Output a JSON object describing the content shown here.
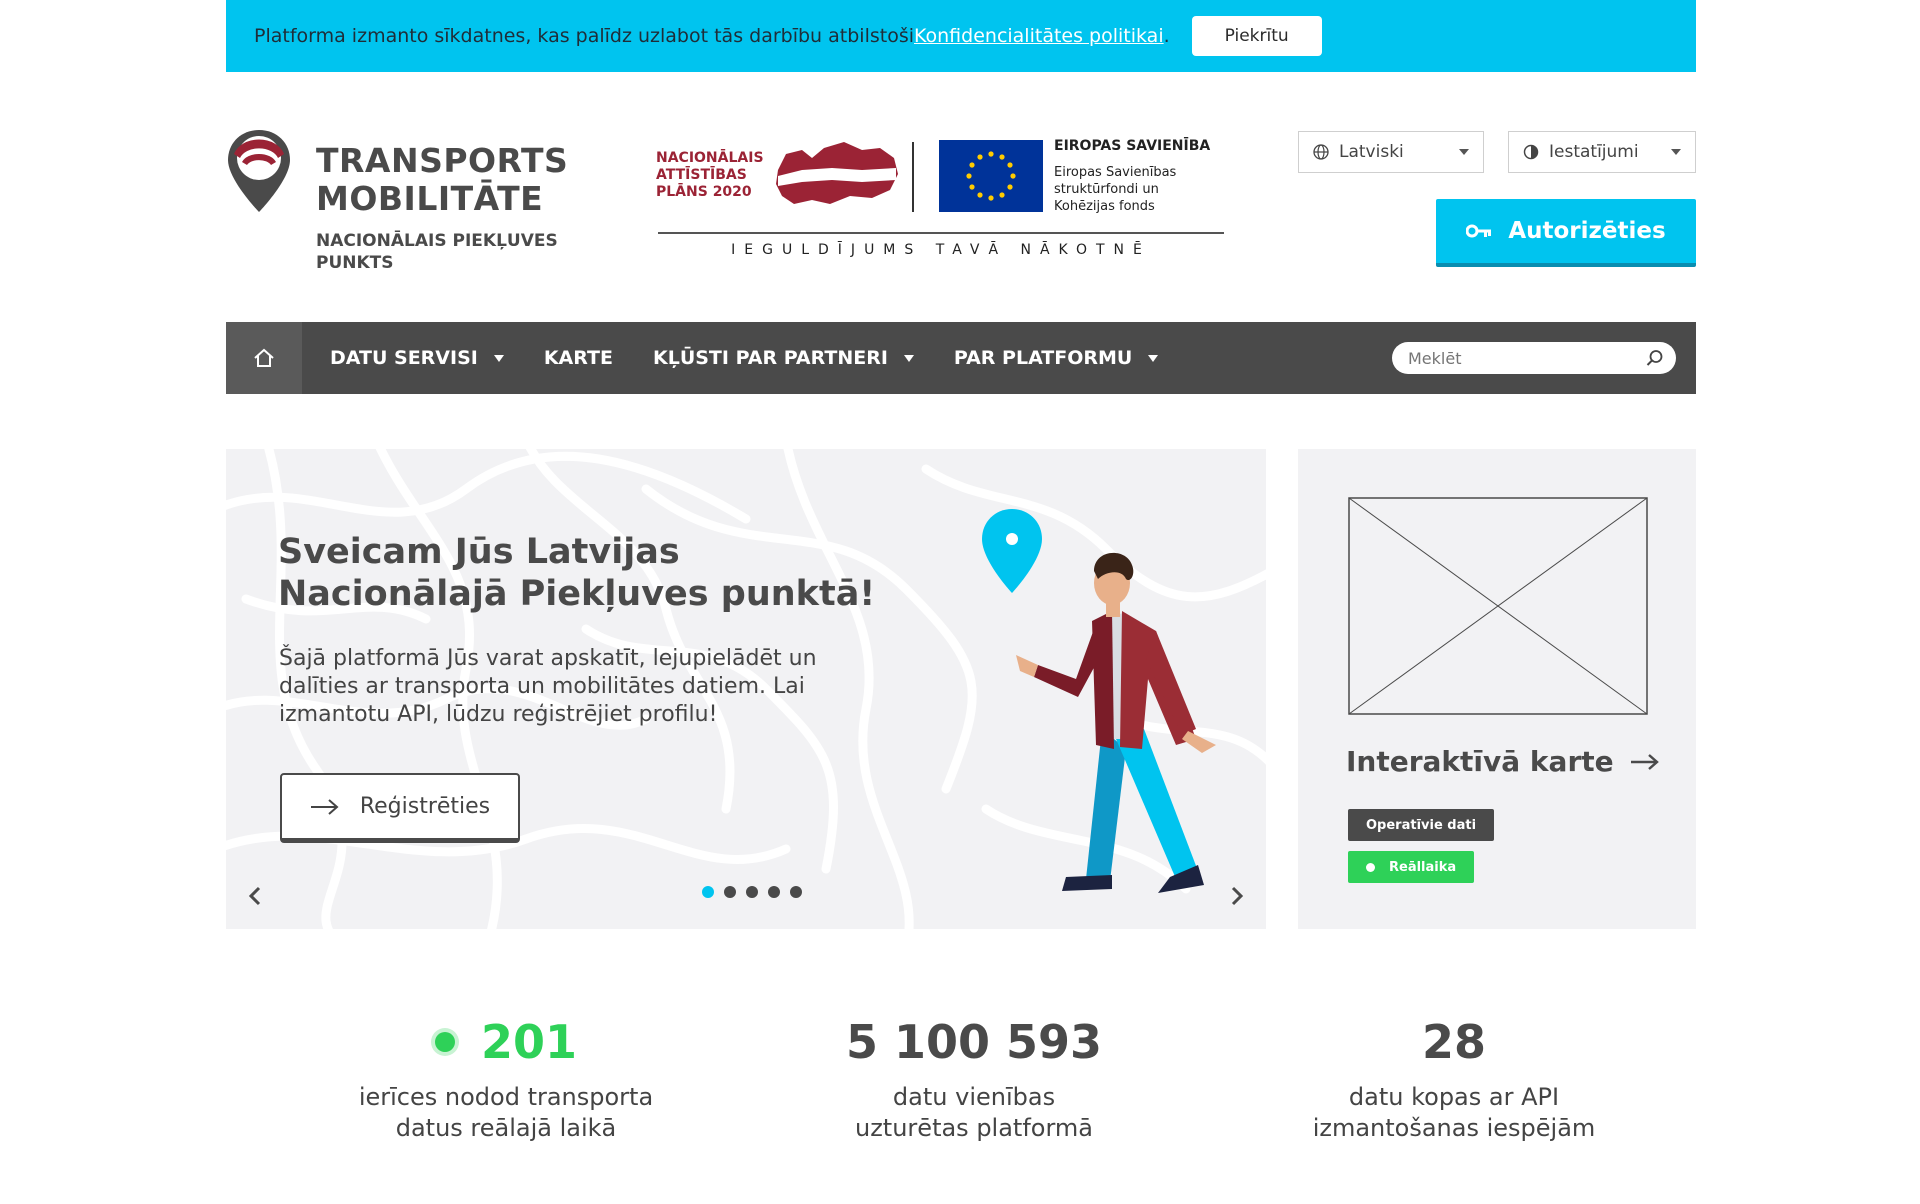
{
  "cookie_banner": {
    "text": "Platforma izmanto sīkdatnes, kas palīdz uzlabot tās darbību atbilstoši ",
    "link": "Konfidencialitātes politikai",
    "after_link": ".",
    "accept_label": "Piekrītu"
  },
  "logo": {
    "title_line1": "TRANSPORTS",
    "title_line2": "MOBILITĀTE",
    "subtitle_line1": "NACIONĀLAIS PIEKĻUVES",
    "subtitle_line2": "PUNKTS"
  },
  "funding": {
    "nap_line1": "NACIONĀLAIS",
    "nap_line2": "ATTĪSTĪBAS",
    "nap_line3": "PLĀNS 2020",
    "eu_title": "EIROPAS SAVIENĪBA",
    "eu_line1": "Eiropas Savienības",
    "eu_line2": "struktūrfondi un",
    "eu_line3": "Kohēzijas fonds",
    "motto": "IEGULDĪJUMS TAVĀ NĀKOTNĒ"
  },
  "header": {
    "language": "Latviski",
    "settings": "Iestatījumi",
    "auth_label": "Autorizēties"
  },
  "nav": {
    "items": [
      {
        "label": "DATU SERVISI",
        "dropdown": true
      },
      {
        "label": "KARTE",
        "dropdown": false
      },
      {
        "label": "KĻŪSTI PAR PARTNERI",
        "dropdown": true
      },
      {
        "label": "PAR PLATFORMU",
        "dropdown": true
      }
    ],
    "search_placeholder": "Meklēt"
  },
  "hero": {
    "title": "Sveicam Jūs Latvijas Nacionālajā Piekļuves punktā!",
    "text": "Šajā platformā Jūs varat apskatīt, lejupielādēt un dalīties ar transporta un mobilitātes datiem. Lai izmantotu API, lūdzu reģistrējiet profilu!",
    "register_label": "Reģistrēties",
    "slides": 5,
    "active_slide": 1
  },
  "map_card": {
    "title": "Interaktīvā karte",
    "tag_operative": "Operatīvie dati",
    "tag_realtime": "Reāllaika"
  },
  "stats": [
    {
      "value": "201",
      "label_line1": "ierīces nodod transporta",
      "label_line2": "datus reālajā laikā",
      "live": true
    },
    {
      "value": "5 100 593",
      "label_line1": "datu vienības",
      "label_line2": "uzturētas platformā",
      "live": false
    },
    {
      "value": "28",
      "label_line1": "datu kopas ar API",
      "label_line2": "izmantošanas iespējām",
      "live": false
    }
  ],
  "colors": {
    "accent": "#00c4ef",
    "dark": "#4a4a4a",
    "green": "#2ed158",
    "brand_red": "#9b2335"
  }
}
